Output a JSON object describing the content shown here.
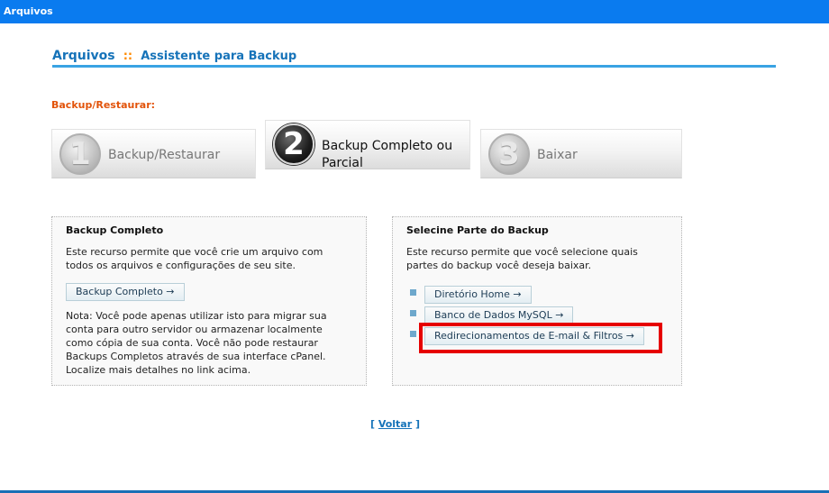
{
  "window": {
    "title": "Arquivos"
  },
  "header": {
    "breadcrumb_main": "Arquivos",
    "breadcrumb_separator": "::",
    "breadcrumb_sub": "Assistente para Backup"
  },
  "section_label": "Backup/Restaurar:",
  "steps": [
    {
      "number": "1",
      "label": "Backup/Restaurar",
      "active": false
    },
    {
      "number": "2",
      "label": "Backup Completo ou Parcial",
      "active": true
    },
    {
      "number": "3",
      "label": "Baixar",
      "active": false
    }
  ],
  "full_backup": {
    "title": "Backup Completo",
    "description": "Este recurso permite que você crie um arquivo com todos os arquivos e configurações de seu site.",
    "button": "Backup Completo →",
    "note": "Nota: Você pode apenas utilizar isto para migrar sua conta para outro servidor ou armazenar localmente como cópia de sua conta. Você não pode restaurar Backups Completos através de sua interface cPanel. Localize mais detalhes no link acima."
  },
  "partial_backup": {
    "title": "Selecine Parte do Backup",
    "description": "Este recurso permite que você selecione quais partes do backup você deseja baixar.",
    "items": [
      {
        "label": "Diretório Home →"
      },
      {
        "label": "Banco de Dados MySQL →"
      },
      {
        "label": "Redirecionamentos de E-mail & Filtros →"
      }
    ]
  },
  "back_link": {
    "open": "[",
    "label": "Voltar",
    "close": "]"
  },
  "colors": {
    "topbar": "#0a7bef",
    "accent": "#1673b9",
    "section_label": "#e2530a",
    "highlight": "#e60000"
  }
}
